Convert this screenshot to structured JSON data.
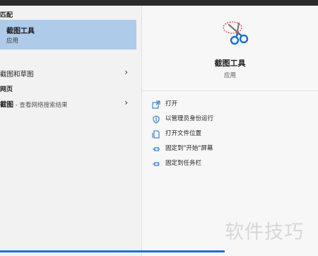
{
  "left": {
    "best_match_label": "匹配",
    "best_match": {
      "title": "截图工具",
      "subtitle": "应用"
    },
    "apps_row": {
      "label": "截图和草图"
    },
    "web_label": "网页",
    "web_row": {
      "query": "截图",
      "suffix": " - 查看网络搜索结果"
    }
  },
  "right": {
    "app_name": "截图工具",
    "app_type": "应用",
    "actions": [
      {
        "label": "打开",
        "icon": "open-icon"
      },
      {
        "label": "以管理员身份运行",
        "icon": "run-as-admin-icon"
      },
      {
        "label": "打开文件位置",
        "icon": "file-location-icon"
      },
      {
        "label": "固定到\"开始\"屏幕",
        "icon": "pin-icon"
      },
      {
        "label": "固定到任务栏",
        "icon": "pin-icon"
      }
    ]
  },
  "watermark": "软件技巧",
  "colors": {
    "selection": "#aecbea",
    "accent": "#1a73d6",
    "icon_blue": "#1a6fc9",
    "icon_red": "#e0333a"
  },
  "icons": {
    "app": "snipping-tool-scissors-icon",
    "chevron": "chevron-right-icon"
  }
}
